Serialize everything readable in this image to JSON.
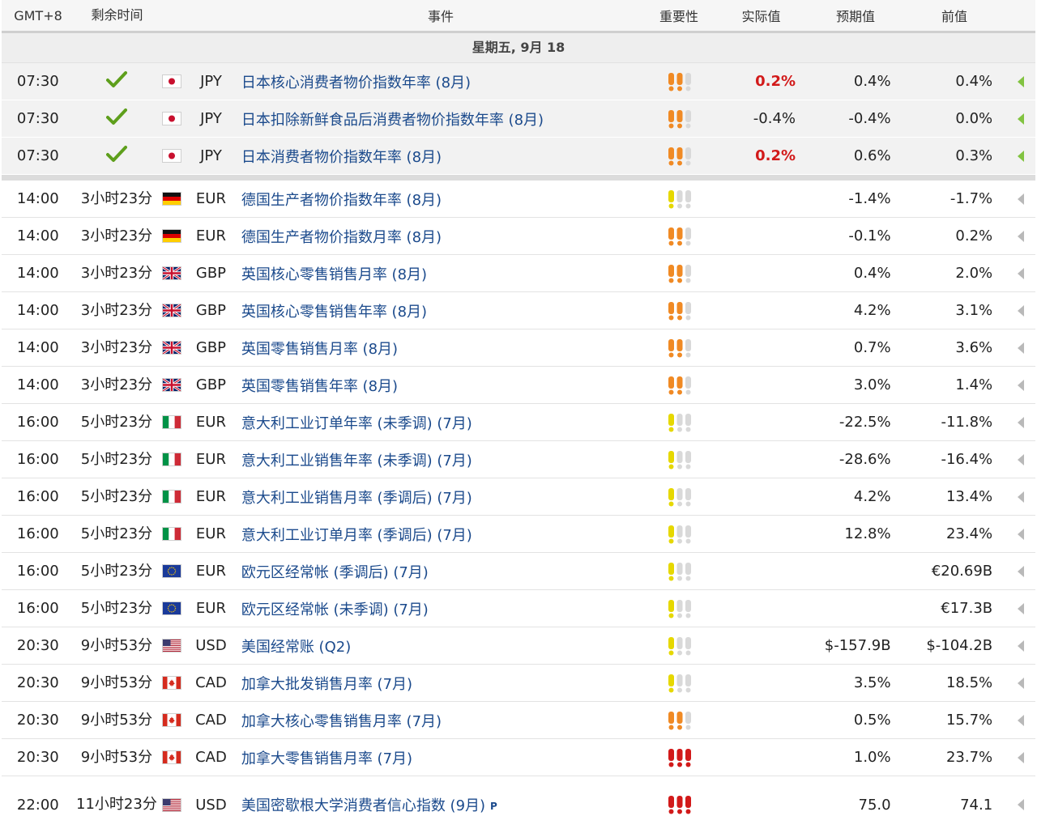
{
  "header": {
    "timezone": "GMT+8",
    "remaining": "剩余时间",
    "event": "事件",
    "importance": "重要性",
    "actual": "实际值",
    "forecast": "预期值",
    "previous": "前值"
  },
  "date_label": "星期五, 9月 18",
  "colors": {
    "event_link": "#1b4a8c",
    "actual_highlight": "#d21a1a",
    "check_green": "#5e9f1c",
    "arrow_green": "#82c341",
    "arrow_gray": "#b9b9b9",
    "importance_low": "#e6d800",
    "importance_medium": "#f08a24",
    "importance_high": "#d21a1a",
    "importance_off": "#d9d9d9"
  },
  "released_rows": [
    {
      "time": "07:30",
      "status_icon": "check-icon",
      "country_flag": "japan-flag-icon",
      "currency": "JPY",
      "event": "日本核心消费者物价指数年率 (8月)",
      "importance_level": 2,
      "actual": "0.2%",
      "actual_highlight": true,
      "forecast": "0.4%",
      "previous": "0.4%",
      "arrow_icon": "triangle-left-green-icon"
    },
    {
      "time": "07:30",
      "status_icon": "check-icon",
      "country_flag": "japan-flag-icon",
      "currency": "JPY",
      "event": "日本扣除新鲜食品后消费者物价指数年率 (8月)",
      "importance_level": 2,
      "actual": "-0.4%",
      "actual_highlight": false,
      "forecast": "-0.4%",
      "previous": "0.0%",
      "arrow_icon": "triangle-left-green-icon"
    },
    {
      "time": "07:30",
      "status_icon": "check-icon",
      "country_flag": "japan-flag-icon",
      "currency": "JPY",
      "event": "日本消费者物价指数年率 (8月)",
      "importance_level": 2,
      "actual": "0.2%",
      "actual_highlight": true,
      "forecast": "0.6%",
      "previous": "0.3%",
      "arrow_icon": "triangle-left-green-icon"
    }
  ],
  "upcoming_rows": [
    {
      "time": "14:00",
      "remaining": "3小时23分",
      "country_flag": "germany-flag-icon",
      "currency": "EUR",
      "event": "德国生产者物价指数年率 (8月)",
      "importance_level": 1,
      "actual": "",
      "forecast": "-1.4%",
      "previous": "-1.7%"
    },
    {
      "time": "14:00",
      "remaining": "3小时23分",
      "country_flag": "germany-flag-icon",
      "currency": "EUR",
      "event": "德国生产者物价指数月率 (8月)",
      "importance_level": 2,
      "actual": "",
      "forecast": "-0.1%",
      "previous": "0.2%"
    },
    {
      "time": "14:00",
      "remaining": "3小时23分",
      "country_flag": "uk-flag-icon",
      "currency": "GBP",
      "event": "英国核心零售销售月率 (8月)",
      "importance_level": 2,
      "actual": "",
      "forecast": "0.4%",
      "previous": "2.0%"
    },
    {
      "time": "14:00",
      "remaining": "3小时23分",
      "country_flag": "uk-flag-icon",
      "currency": "GBP",
      "event": "英国核心零售销售年率 (8月)",
      "importance_level": 2,
      "actual": "",
      "forecast": "4.2%",
      "previous": "3.1%"
    },
    {
      "time": "14:00",
      "remaining": "3小时23分",
      "country_flag": "uk-flag-icon",
      "currency": "GBP",
      "event": "英国零售销售月率 (8月)",
      "importance_level": 2,
      "actual": "",
      "forecast": "0.7%",
      "previous": "3.6%"
    },
    {
      "time": "14:00",
      "remaining": "3小时23分",
      "country_flag": "uk-flag-icon",
      "currency": "GBP",
      "event": "英国零售销售年率 (8月)",
      "importance_level": 2,
      "actual": "",
      "forecast": "3.0%",
      "previous": "1.4%"
    },
    {
      "time": "16:00",
      "remaining": "5小时23分",
      "country_flag": "italy-flag-icon",
      "currency": "EUR",
      "event": "意大利工业订单年率 (未季调) (7月)",
      "importance_level": 1,
      "actual": "",
      "forecast": "-22.5%",
      "previous": "-11.8%"
    },
    {
      "time": "16:00",
      "remaining": "5小时23分",
      "country_flag": "italy-flag-icon",
      "currency": "EUR",
      "event": "意大利工业销售年率 (未季调) (7月)",
      "importance_level": 1,
      "actual": "",
      "forecast": "-28.6%",
      "previous": "-16.4%"
    },
    {
      "time": "16:00",
      "remaining": "5小时23分",
      "country_flag": "italy-flag-icon",
      "currency": "EUR",
      "event": "意大利工业销售月率 (季调后) (7月)",
      "importance_level": 1,
      "actual": "",
      "forecast": "4.2%",
      "previous": "13.4%"
    },
    {
      "time": "16:00",
      "remaining": "5小时23分",
      "country_flag": "italy-flag-icon",
      "currency": "EUR",
      "event": "意大利工业订单月率 (季调后) (7月)",
      "importance_level": 1,
      "actual": "",
      "forecast": "12.8%",
      "previous": "23.4%"
    },
    {
      "time": "16:00",
      "remaining": "5小时23分",
      "country_flag": "eu-flag-icon",
      "currency": "EUR",
      "event": "欧元区经常帐 (季调后) (7月)",
      "importance_level": 1,
      "actual": "",
      "forecast": "",
      "previous": "€20.69B"
    },
    {
      "time": "16:00",
      "remaining": "5小时23分",
      "country_flag": "eu-flag-icon",
      "currency": "EUR",
      "event": "欧元区经常帐 (未季调) (7月)",
      "importance_level": 1,
      "actual": "",
      "forecast": "",
      "previous": "€17.3B"
    },
    {
      "time": "20:30",
      "remaining": "9小时53分",
      "country_flag": "usa-flag-icon",
      "currency": "USD",
      "event": "美国经常账 (Q2)",
      "importance_level": 1,
      "actual": "",
      "forecast": "$-157.9B",
      "previous": "$-104.2B"
    },
    {
      "time": "20:30",
      "remaining": "9小时53分",
      "country_flag": "canada-flag-icon",
      "currency": "CAD",
      "event": "加拿大批发销售月率 (7月)",
      "importance_level": 1,
      "actual": "",
      "forecast": "3.5%",
      "previous": "18.5%"
    },
    {
      "time": "20:30",
      "remaining": "9小时53分",
      "country_flag": "canada-flag-icon",
      "currency": "CAD",
      "event": "加拿大核心零售销售月率 (7月)",
      "importance_level": 2,
      "actual": "",
      "forecast": "0.5%",
      "previous": "15.7%"
    },
    {
      "time": "20:30",
      "remaining": "9小时53分",
      "country_flag": "canada-flag-icon",
      "currency": "CAD",
      "event": "加拿大零售销售月率 (7月)",
      "importance_level": 3,
      "actual": "",
      "forecast": "1.0%",
      "previous": "23.7%"
    },
    {
      "time": "22:00",
      "remaining": "11小时23分",
      "country_flag": "usa-flag-icon",
      "currency": "USD",
      "event": "美国密歇根大学消费者信心指数 (9月)",
      "event_badge": "P",
      "importance_level": 3,
      "actual": "",
      "forecast": "75.0",
      "previous": "74.1"
    }
  ]
}
